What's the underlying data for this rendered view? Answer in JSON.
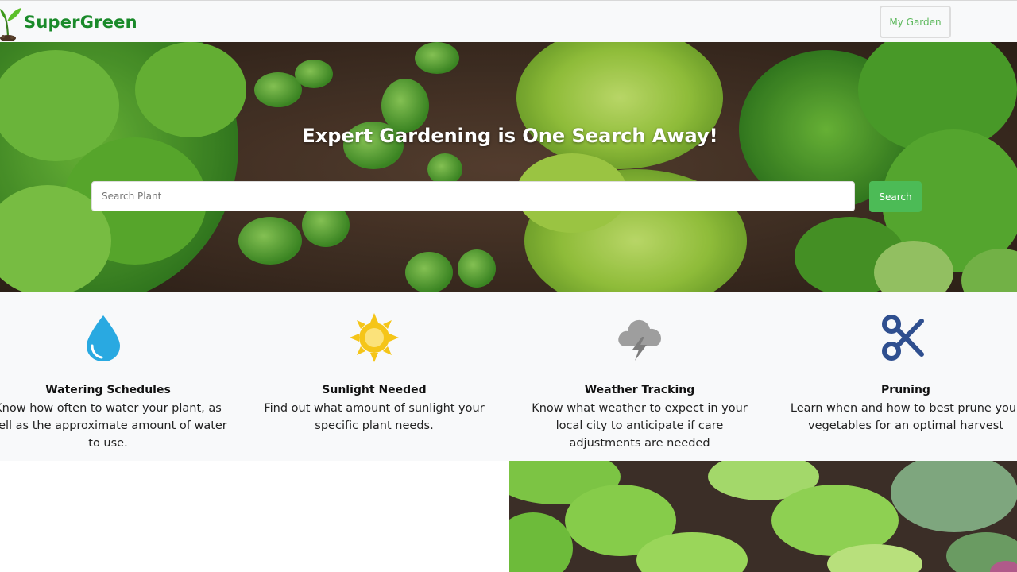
{
  "brand": {
    "name": "SuperGreen",
    "logo": "seedling-logo"
  },
  "navbar": {
    "my_garden_label": "My Garden"
  },
  "hero": {
    "title": "Expert Gardening is One Search Away!",
    "search_placeholder": "Search Plant",
    "search_button": "Search"
  },
  "features": [
    {
      "icon": "water-drop-icon",
      "title": "Watering Schedules",
      "description": "Know how often to water your plant, as well as the approximate amount of water to use."
    },
    {
      "icon": "sun-icon",
      "title": "Sunlight Needed",
      "description": "Find out what amount of sunlight your specific plant needs."
    },
    {
      "icon": "storm-cloud-icon",
      "title": "Weather Tracking",
      "description": "Know what weather to expect in your local city to anticipate if care adjustments are needed"
    },
    {
      "icon": "scissors-icon",
      "title": "Pruning",
      "description": "Learn when and how to best prune your vegetables for an optimal harvest"
    }
  ],
  "colors": {
    "brand_green": "#1a8a2a",
    "accent_green": "#4cbb56",
    "nav_bg": "#f8f9fa",
    "water_blue": "#29a9e1",
    "sun_yellow": "#f5c518",
    "cloud_gray": "#9e9e9e",
    "scissors_navy": "#2f4f8f"
  }
}
